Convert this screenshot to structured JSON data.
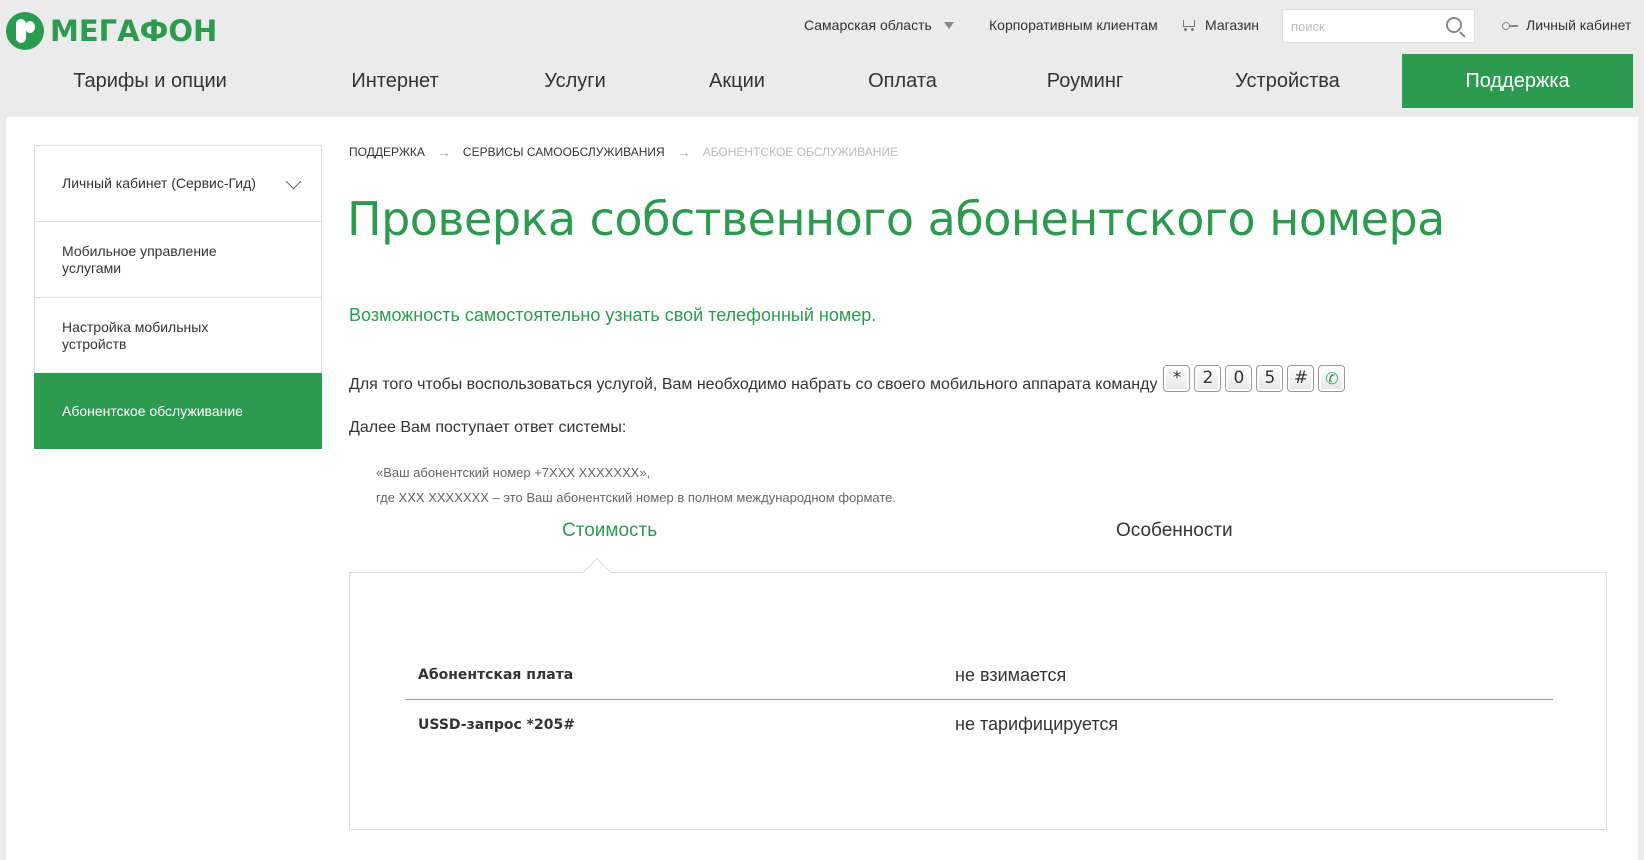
{
  "header": {
    "logo_text": "МЕГАФОН",
    "region": "Самарская область",
    "corporate": "Корпоративным клиентам",
    "shop": "Магазин",
    "search_placeholder": "поиск",
    "cabinet": "Личный кабинет"
  },
  "nav": {
    "items": [
      {
        "label": "Тарифы и опции"
      },
      {
        "label": "Интернет"
      },
      {
        "label": "Услуги"
      },
      {
        "label": "Акции"
      },
      {
        "label": "Оплата"
      },
      {
        "label": "Роуминг"
      },
      {
        "label": "Устройства"
      },
      {
        "label": "Поддержка",
        "active": true
      }
    ]
  },
  "sidebar": {
    "items": [
      {
        "label": "Личный кабинет (Сервис-Гид)",
        "expandable": true
      },
      {
        "label": "Мобильное управление услугами"
      },
      {
        "label": "Настройка мобильных устройств"
      },
      {
        "label": "Абонентское обслуживание",
        "active": true
      }
    ]
  },
  "breadcrumb": {
    "items": [
      "Поддержка",
      "Сервисы самообслуживания"
    ],
    "current": "Абонентское обслуживание",
    "separator": "→"
  },
  "main": {
    "title": "Проверка собственного абонентского номера",
    "subtitle": "Возможность самостоятельно узнать свой телефонный номер.",
    "instruction": "Для того чтобы воспользоваться услугой, Вам необходимо набрать со своего мобильного аппарата команду",
    "command_keys": [
      "*",
      "2",
      "0",
      "5",
      "#"
    ],
    "followup": "Далее Вам поступает ответ системы:",
    "reply_line1": "«Ваш абонентский номер +7XXX XXXXXXX»,",
    "reply_line2": "где XXX XXXXXXX – это Ваш абонентский номер в полном международном формате."
  },
  "tabs": {
    "cost": "Стоимость",
    "features": "Особенности",
    "active": "cost"
  },
  "pricing": {
    "rows": [
      {
        "label": "Абонентская плата",
        "value": "не взимается"
      },
      {
        "label": "USSD-запрос *205#",
        "value": "не тарифицируется"
      }
    ]
  },
  "colors": {
    "brand_green": "#2c9b4f",
    "background": "#ebebeb"
  },
  "icons": [
    "megafon-logo",
    "chevron-down-icon",
    "cart-icon",
    "search-icon",
    "key-icon",
    "phone-call-icon"
  ]
}
